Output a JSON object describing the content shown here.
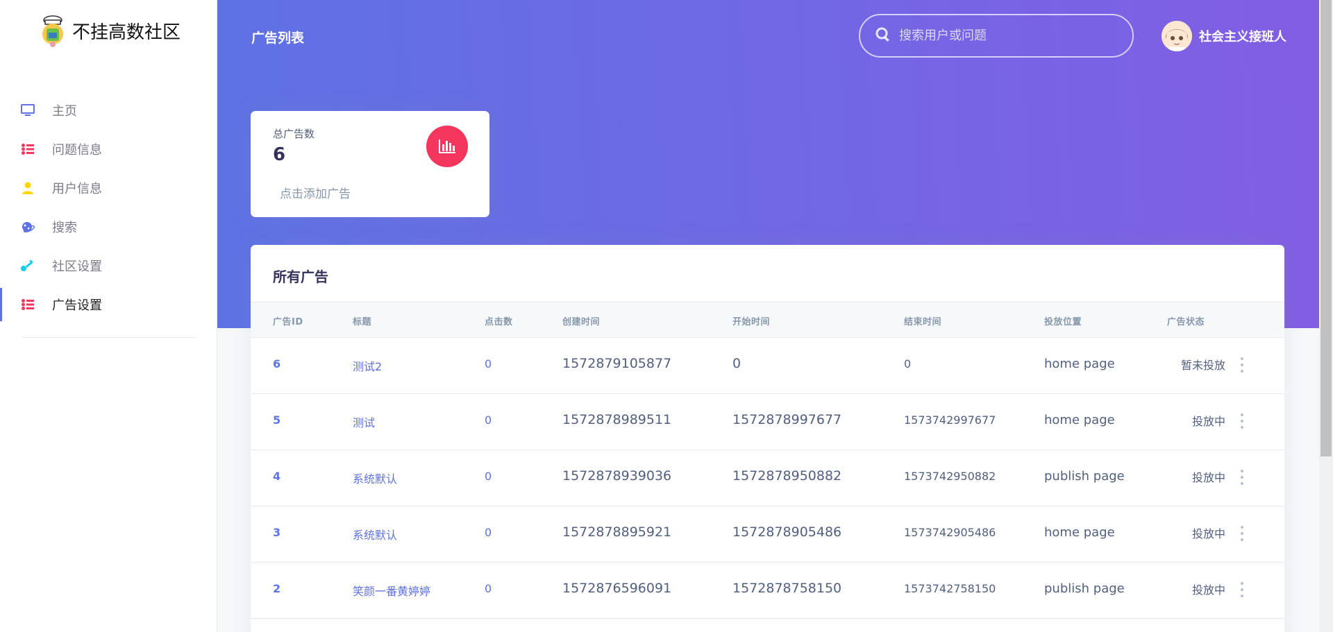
{
  "brand": {
    "name": "不挂高数社区"
  },
  "sidebar": {
    "items": [
      {
        "label": "主页",
        "icon": "monitor-icon",
        "color": "#5e72e4"
      },
      {
        "label": "问题信息",
        "icon": "list-icon",
        "color": "#f5365c"
      },
      {
        "label": "用户信息",
        "icon": "user-icon",
        "color": "#ffd600"
      },
      {
        "label": "搜索",
        "icon": "planet-icon",
        "color": "#5e72e4"
      },
      {
        "label": "社区设置",
        "icon": "key-icon",
        "color": "#11cdef"
      },
      {
        "label": "广告设置",
        "icon": "list-icon",
        "color": "#f5365c"
      }
    ]
  },
  "header": {
    "title": "广告列表",
    "search_placeholder": "搜索用户或问题",
    "user_name": "社会主义接班人"
  },
  "stat": {
    "label": "总广告数",
    "value": "6",
    "link": "点击添加广告"
  },
  "table": {
    "title": "所有广告",
    "columns": [
      "广告ID",
      "标题",
      "点击数",
      "创建时间",
      "开始时间",
      "结束时间",
      "投放位置",
      "广告状态"
    ],
    "rows": [
      {
        "id": "6",
        "title": "测试2",
        "clicks": "0",
        "created": "1572879105877",
        "start": "0",
        "end": "0",
        "position": "home page",
        "status": "暂未投放"
      },
      {
        "id": "5",
        "title": "测试",
        "clicks": "0",
        "created": "1572878989511",
        "start": "1572878997677",
        "end": "1573742997677",
        "position": "home page",
        "status": "投放中"
      },
      {
        "id": "4",
        "title": "系统默认",
        "clicks": "0",
        "created": "1572878939036",
        "start": "1572878950882",
        "end": "1573742950882",
        "position": "publish page",
        "status": "投放中"
      },
      {
        "id": "3",
        "title": "系统默认",
        "clicks": "0",
        "created": "1572878895921",
        "start": "1572878905486",
        "end": "1573742905486",
        "position": "home page",
        "status": "投放中"
      },
      {
        "id": "2",
        "title": "笑颜一番黄婷婷",
        "clicks": "0",
        "created": "1572876596091",
        "start": "1572878758150",
        "end": "1573742758150",
        "position": "publish page",
        "status": "投放中"
      }
    ]
  },
  "colors": {
    "primary": "#5e72e4",
    "gradient_end": "#825ee4",
    "danger": "#f5365c",
    "warning": "#ffd600",
    "info": "#11cdef"
  }
}
